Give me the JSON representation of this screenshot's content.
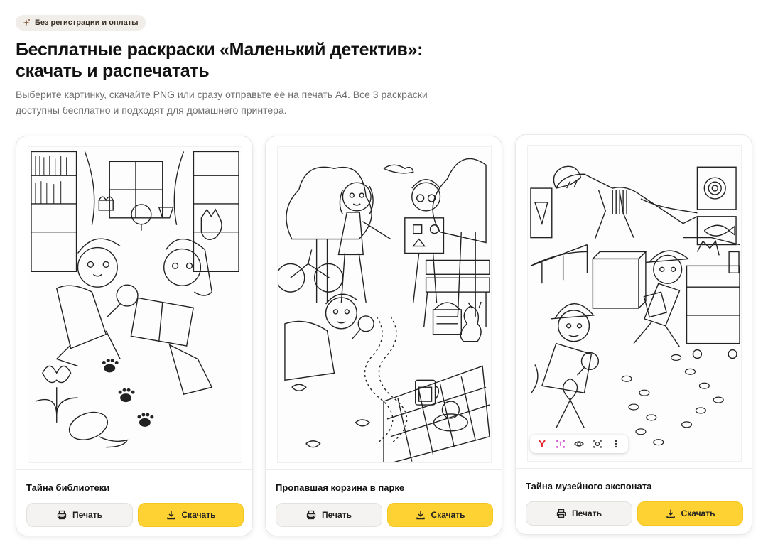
{
  "badge": {
    "icon": "sparkle-icon",
    "label": "Без регистрации и оплаты"
  },
  "page": {
    "title_line1": "Бесплатные раскраски «Маленький детектив»:",
    "title_line2": "скачать и распечатать",
    "subtitle_line1": "Выберите картинку, скачайте PNG или сразу отправьте её на печать А4. Все 3 раскраски",
    "subtitle_line2": "доступны бесплатно и подходят для домашнего принтера."
  },
  "cards": [
    {
      "title": "Тайна библиотеки",
      "print_label": "Печать",
      "download_label": "Скачать"
    },
    {
      "title": "Пропавшая корзина в парке",
      "print_label": "Печать",
      "download_label": "Скачать"
    },
    {
      "title": "Тайна музейного экспоната",
      "print_label": "Печать",
      "download_label": "Скачать"
    }
  ],
  "image_toolbar": {
    "icons": [
      "yandex-icon",
      "text-select-icon",
      "eye-icon",
      "camera-icon",
      "more-icon"
    ]
  },
  "colors": {
    "accent": "#ffd234",
    "badge_bg": "#f1eeea",
    "text": "#111111",
    "muted": "#6f6f6f"
  }
}
